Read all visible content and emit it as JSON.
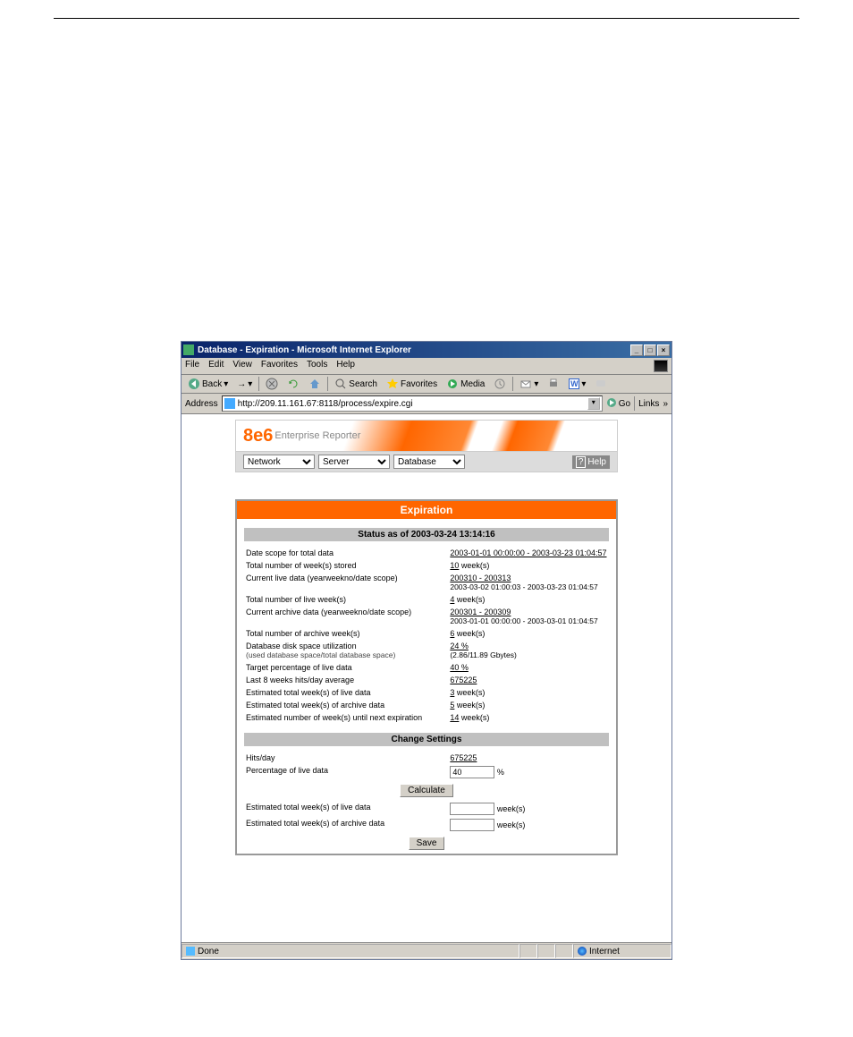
{
  "titlebar": {
    "title": "Database - Expiration - Microsoft Internet Explorer"
  },
  "menus": [
    "File",
    "Edit",
    "View",
    "Favorites",
    "Tools",
    "Help"
  ],
  "toolbar": {
    "back": "Back",
    "search": "Search",
    "favorites": "Favorites",
    "media": "Media"
  },
  "address": {
    "label": "Address",
    "url": "http://209.11.161.67:8118/process/expire.cgi",
    "go": "Go",
    "links": "Links"
  },
  "banner": {
    "logo": "8e6",
    "sub": "Enterprise Reporter"
  },
  "selects": {
    "network": "Network",
    "server": "Server",
    "database": "Database",
    "help": "Help"
  },
  "panel": {
    "title": "Expiration",
    "statusHeader": "Status as of 2003-03-24 13:14:16",
    "rows": [
      {
        "label": "Date scope for total data",
        "value": "2003-01-01 00:00:00 - 2003-03-23 01:04:57",
        "underline": true
      },
      {
        "label": "Total number of week(s) stored",
        "value_u": "10",
        "value_n": " week(s)"
      },
      {
        "label": "Current live data (yearweekno/date scope)",
        "value_u": "200310 - 200313",
        "value_s": "2003-03-02 01:00:03 - 2003-03-23 01:04:57"
      },
      {
        "label": "Total number of live week(s)",
        "value_u": "4",
        "value_n": " week(s)"
      },
      {
        "label": "Current archive data (yearweekno/date scope)",
        "value_u": "200301 - 200309",
        "value_s": "2003-01-01 00:00:00 - 2003-03-01 01:04:57"
      },
      {
        "label": "Total number of archive week(s)",
        "value_u": "6",
        "value_n": " week(s)"
      },
      {
        "label": "Database disk space utilization",
        "label_sub": "(used database space/total database space)",
        "value_u": "24 %",
        "value_s": "(2.86/11.89 Gbytes)"
      },
      {
        "label": "Target percentage of live data",
        "value_u": "40 %"
      },
      {
        "label": "Last 8 weeks hits/day average",
        "value_u": "675225"
      },
      {
        "label": "Estimated total week(s) of live data",
        "value_u": "3",
        "value_n": " week(s)"
      },
      {
        "label": "Estimated total week(s) of archive data",
        "value_u": "5",
        "value_n": " week(s)"
      },
      {
        "label": "Estimated number of week(s) until next expiration",
        "value_u": "14",
        "value_n": " week(s)"
      }
    ],
    "settingsHeader": "Change Settings",
    "settings": {
      "hitsday_label": "Hits/day",
      "hitsday_value": "675225",
      "pct_label": "Percentage of live data",
      "pct_value": "40",
      "pct_unit": "%",
      "calculate": "Calculate",
      "est_live_label": "Estimated total week(s) of live data",
      "est_live_unit": "week(s)",
      "est_arch_label": "Estimated total week(s) of archive data",
      "est_arch_unit": "week(s)",
      "save": "Save"
    }
  },
  "statusbar": {
    "done": "Done",
    "zone": "Internet"
  }
}
